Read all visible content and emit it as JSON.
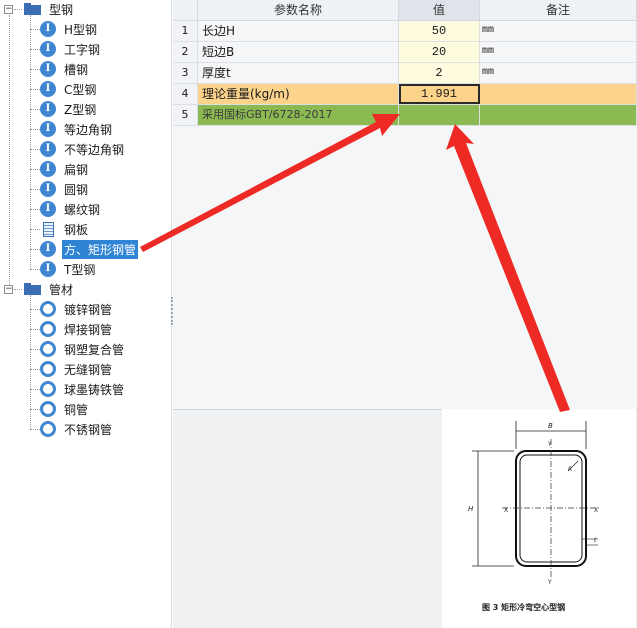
{
  "tree": {
    "groups": [
      {
        "label": "型钢",
        "toggle": "−",
        "items": [
          {
            "label": "H型钢",
            "icon": "I"
          },
          {
            "label": "工字钢",
            "icon": "I"
          },
          {
            "label": "槽钢",
            "icon": "I"
          },
          {
            "label": "C型钢",
            "icon": "I"
          },
          {
            "label": "Z型钢",
            "icon": "I"
          },
          {
            "label": "等边角钢",
            "icon": "I"
          },
          {
            "label": "不等边角钢",
            "icon": "I"
          },
          {
            "label": "扁钢",
            "icon": "I"
          },
          {
            "label": "圆钢",
            "icon": "I"
          },
          {
            "label": "螺纹钢",
            "icon": "I"
          },
          {
            "label": "钢板",
            "icon": "plate"
          },
          {
            "label": "方、矩形钢管",
            "icon": "I",
            "selected": true
          },
          {
            "label": "T型钢",
            "icon": "I"
          }
        ]
      },
      {
        "label": "管材",
        "toggle": "−",
        "items": [
          {
            "label": "镀锌钢管",
            "icon": "ring"
          },
          {
            "label": "焊接钢管",
            "icon": "ring"
          },
          {
            "label": "钢塑复合管",
            "icon": "ring"
          },
          {
            "label": "无缝钢管",
            "icon": "ring"
          },
          {
            "label": "球墨铸铁管",
            "icon": "ring"
          },
          {
            "label": "铜管",
            "icon": "ring"
          },
          {
            "label": "不锈钢管",
            "icon": "ring"
          }
        ]
      }
    ]
  },
  "grid": {
    "headers": {
      "name": "参数名称",
      "value": "值",
      "note": "备注"
    },
    "rows": [
      {
        "num": "1",
        "name": "长边H",
        "value": "50",
        "note": "mm",
        "style": ""
      },
      {
        "num": "2",
        "name": "短边B",
        "value": "20",
        "note": "mm",
        "style": ""
      },
      {
        "num": "3",
        "name": "厚度t",
        "value": "2",
        "note": "mm",
        "style": ""
      },
      {
        "num": "4",
        "name": "理论重量(kg/m)",
        "value": "1.991",
        "note": "",
        "style": "orange"
      },
      {
        "num": "5",
        "name": "采用国标GBT/6728-2017",
        "value": "",
        "note": "",
        "style": "green"
      }
    ]
  },
  "figure": {
    "caption": "图 3   矩形冷弯空心型钢",
    "labels": {
      "B": "B",
      "Y": "Y",
      "R": "R",
      "H": "H",
      "X": "X",
      "t": "t"
    }
  },
  "colors": {
    "accent": "#2f84d6",
    "icon_blue": "#3f86d0",
    "row_orange": "#fbd38a",
    "row_green": "#8cba52",
    "value_col": "#fffbdf",
    "arrow_red": "#ee2a24"
  }
}
